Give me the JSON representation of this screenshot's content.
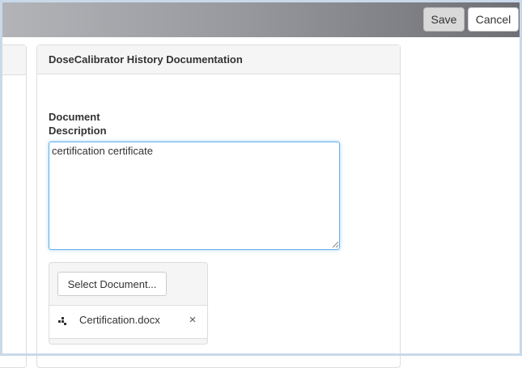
{
  "toolbar": {
    "save_label": "Save",
    "cancel_label": "Cancel"
  },
  "panel": {
    "title": "DoseCalibrator History Documentation"
  },
  "form": {
    "description_label_line1": "Document",
    "description_label_line2": "Description",
    "description_value": "certification certificate"
  },
  "upload": {
    "select_label": "Select Document...",
    "files": [
      {
        "name": "Certification.docx",
        "remove_glyph": "×"
      }
    ]
  },
  "colors": {
    "focus_border": "#66afe9",
    "panel_heading_bg": "#f5f5f5",
    "topbar_gradient_start": "#b3b4b8",
    "topbar_gradient_end": "#6e6f74"
  },
  "icons": {
    "file": "file-type-icon",
    "remove": "close-icon",
    "resize": "resize-grip-icon"
  }
}
